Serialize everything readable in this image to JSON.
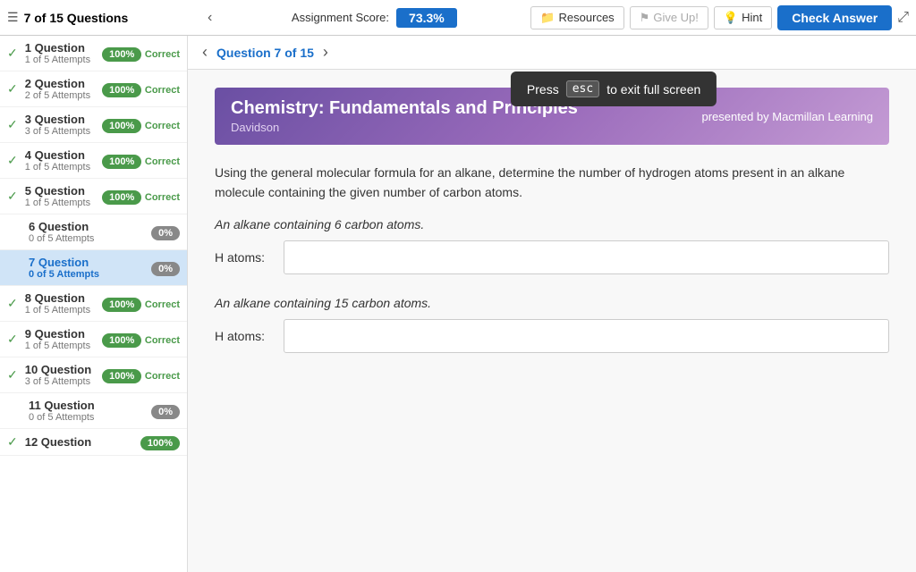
{
  "topbar": {
    "questions_count": "7 of 15 Questions",
    "assignment_score_label": "Assignment Score:",
    "score_value": "73.3%",
    "resources_label": "Resources",
    "giveup_label": "Give Up!",
    "hint_label": "Hint",
    "check_answer_label": "Check Answer"
  },
  "tooltip": {
    "press_text": "Press",
    "esc_key": "esc",
    "suffix_text": "to exit full screen"
  },
  "question_nav": {
    "label": "Question 7 of 15"
  },
  "course": {
    "title": "Chemistry: Fundamentals and Principles",
    "subtitle": "Davidson",
    "publisher": "presented by Macmillan Learning"
  },
  "question": {
    "main_text": "Using the general molecular formula for an alkane, determine the number of hydrogen atoms present in an alkane molecule containing the given number of carbon atoms.",
    "sub1_text": "An alkane containing 6 carbon atoms.",
    "sub1_label": "H atoms:",
    "sub1_placeholder": "",
    "sub2_text": "An alkane containing 15 carbon atoms.",
    "sub2_label": "H atoms:",
    "sub2_placeholder": ""
  },
  "sidebar": {
    "items": [
      {
        "id": 1,
        "title": "1 Question",
        "subtitle": "1 of 5 Attempts",
        "badge": "100%",
        "badge_type": "green",
        "status": "Correct",
        "has_check": true
      },
      {
        "id": 2,
        "title": "2 Question",
        "subtitle": "2 of 5 Attempts",
        "badge": "100%",
        "badge_type": "green",
        "status": "Correct",
        "has_check": true
      },
      {
        "id": 3,
        "title": "3 Question",
        "subtitle": "3 of 5 Attempts",
        "badge": "100%",
        "badge_type": "green",
        "status": "Correct",
        "has_check": true
      },
      {
        "id": 4,
        "title": "4 Question",
        "subtitle": "1 of 5 Attempts",
        "badge": "100%",
        "badge_type": "green",
        "status": "Correct",
        "has_check": true
      },
      {
        "id": 5,
        "title": "5 Question",
        "subtitle": "1 of 5 Attempts",
        "badge": "100%",
        "badge_type": "green",
        "status": "Correct",
        "has_check": true
      },
      {
        "id": 6,
        "title": "6 Question",
        "subtitle": "0 of 5 Attempts",
        "badge": "0%",
        "badge_type": "gray",
        "status": "",
        "has_check": false
      },
      {
        "id": 7,
        "title": "7 Question",
        "subtitle": "0 of 5 Attempts",
        "badge": "0%",
        "badge_type": "gray",
        "status": "",
        "has_check": false,
        "active": true
      },
      {
        "id": 8,
        "title": "8 Question",
        "subtitle": "1 of 5 Attempts",
        "badge": "100%",
        "badge_type": "green",
        "status": "Correct",
        "has_check": true
      },
      {
        "id": 9,
        "title": "9 Question",
        "subtitle": "1 of 5 Attempts",
        "badge": "100%",
        "badge_type": "green",
        "status": "Correct",
        "has_check": true
      },
      {
        "id": 10,
        "title": "10 Question",
        "subtitle": "3 of 5 Attempts",
        "badge": "100%",
        "badge_type": "green",
        "status": "Correct",
        "has_check": true
      },
      {
        "id": 11,
        "title": "11 Question",
        "subtitle": "0 of 5 Attempts",
        "badge": "0%",
        "badge_type": "gray",
        "status": "",
        "has_check": false
      },
      {
        "id": 12,
        "title": "12 Question",
        "subtitle": "",
        "badge": "100%",
        "badge_type": "green",
        "status": "",
        "has_check": true
      }
    ]
  }
}
